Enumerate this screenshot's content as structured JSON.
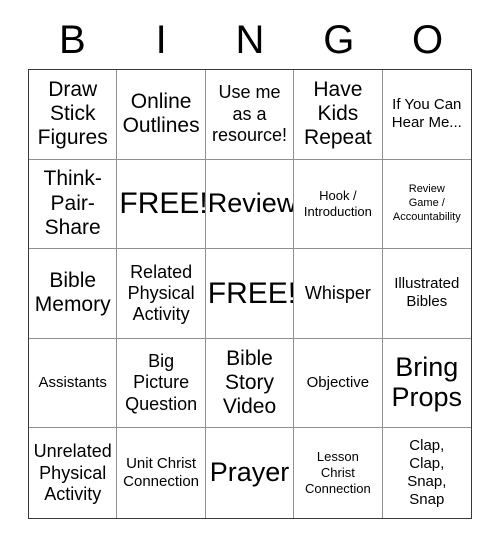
{
  "header": {
    "letters": [
      "B",
      "I",
      "N",
      "G",
      "O"
    ]
  },
  "grid": {
    "columns": 5,
    "rows": 5,
    "cells": [
      {
        "text": "Draw\nStick\nFigures",
        "size": "lg"
      },
      {
        "text": "Online\nOutlines",
        "size": "lg"
      },
      {
        "text": "Use me\nas a\nresource!",
        "size": "md"
      },
      {
        "text": "Have\nKids\nRepeat",
        "size": "lg"
      },
      {
        "text": "If You Can\nHear Me...",
        "size": "sm"
      },
      {
        "text": "Think-\nPair-\nShare",
        "size": "lg"
      },
      {
        "text": "FREE!",
        "size": "xxl"
      },
      {
        "text": "Review",
        "size": "xl"
      },
      {
        "text": "Hook /\nIntroduction",
        "size": "xs"
      },
      {
        "text": "Review\nGame /\nAccountability",
        "size": "xxs"
      },
      {
        "text": "Bible\nMemory",
        "size": "lg"
      },
      {
        "text": "Related\nPhysical\nActivity",
        "size": "md"
      },
      {
        "text": "FREE!",
        "size": "xxl"
      },
      {
        "text": "Whisper",
        "size": "md"
      },
      {
        "text": "Illustrated\nBibles",
        "size": "sm"
      },
      {
        "text": "Assistants",
        "size": "sm"
      },
      {
        "text": "Big\nPicture\nQuestion",
        "size": "md"
      },
      {
        "text": "Bible\nStory\nVideo",
        "size": "lg"
      },
      {
        "text": "Objective",
        "size": "sm"
      },
      {
        "text": "Bring\nProps",
        "size": "xl"
      },
      {
        "text": "Unrelated\nPhysical\nActivity",
        "size": "md"
      },
      {
        "text": "Unit Christ\nConnection",
        "size": "sm"
      },
      {
        "text": "Prayer",
        "size": "xl"
      },
      {
        "text": "Lesson\nChrist\nConnection",
        "size": "xs"
      },
      {
        "text": "Clap,\nClap,\nSnap,\nSnap",
        "size": "sm"
      }
    ]
  },
  "colors": {
    "background": "#ffffff",
    "text": "#000000",
    "grid_line": "#909090",
    "outer_border": "#3a3a3a"
  }
}
